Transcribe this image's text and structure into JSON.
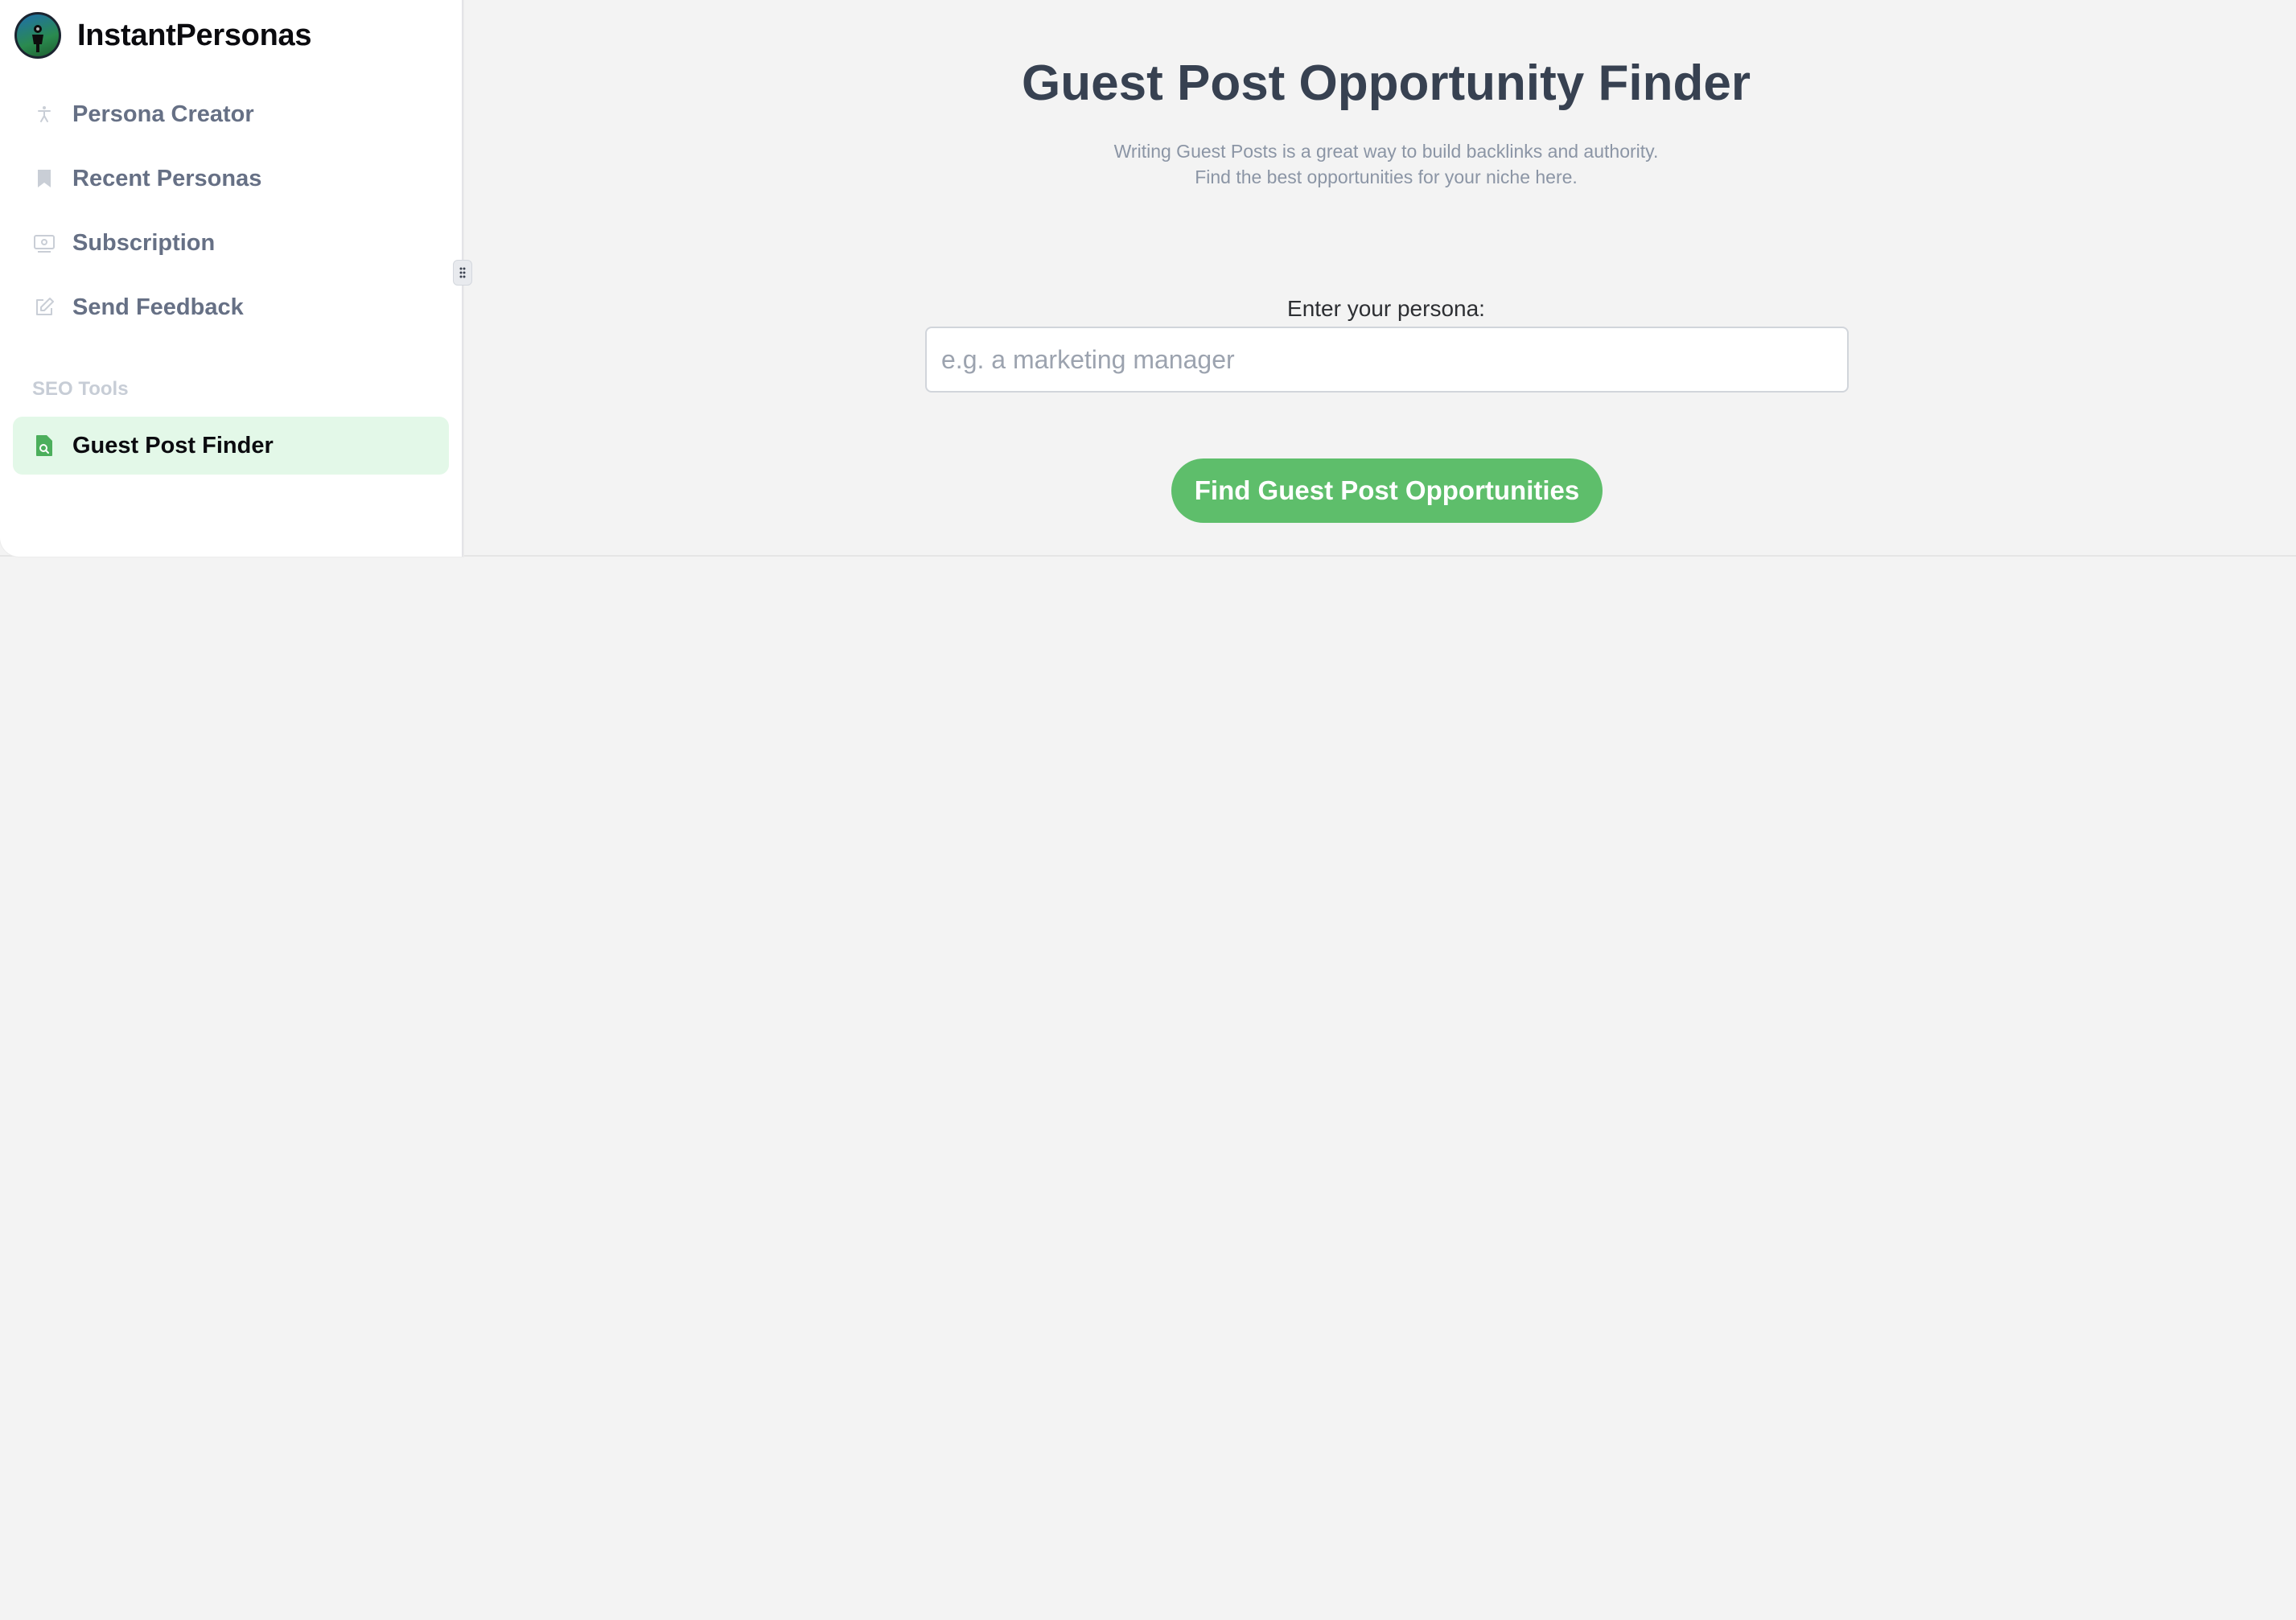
{
  "brand": {
    "name": "InstantPersonas",
    "logo_icon": "person-globe-logo"
  },
  "sidebar": {
    "items": [
      {
        "label": "Persona Creator",
        "icon": "accessibility-icon"
      },
      {
        "label": "Recent Personas",
        "icon": "bookmark-icon"
      },
      {
        "label": "Subscription",
        "icon": "id-card-icon"
      },
      {
        "label": "Send Feedback",
        "icon": "edit-icon"
      }
    ],
    "section_label": "SEO Tools",
    "active_item": {
      "label": "Guest Post Finder",
      "icon": "file-search-icon"
    }
  },
  "main": {
    "title": "Guest Post Opportunity Finder",
    "subtitle_line1": "Writing Guest Posts is a great way to build backlinks and authority.",
    "subtitle_line2": "Find the best opportunities for your niche here.",
    "persona_label": "Enter your persona:",
    "persona_input": {
      "value": "",
      "placeholder": "e.g. a marketing manager"
    },
    "submit_label": "Find Guest Post Opportunities"
  },
  "colors": {
    "accent_green": "#5ebe6b",
    "active_bg": "#e3f8e8",
    "nav_text": "#667085",
    "title_text": "#374151",
    "page_bg": "#f3f3f3"
  }
}
